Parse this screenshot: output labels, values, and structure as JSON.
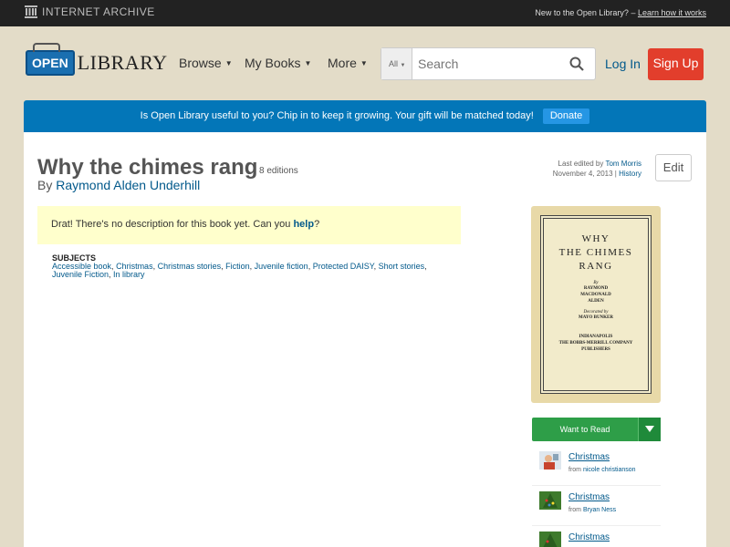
{
  "ia_bar": {
    "logo_text": "INTERNET ARCHIVE",
    "new_text": "New to the Open Library?",
    "learn_link": "Learn how it works"
  },
  "header": {
    "logo_open": "OPEN",
    "logo_library": "LIBRARY",
    "nav": {
      "browse": "Browse",
      "my_books": "My Books",
      "more": "More"
    },
    "search": {
      "scope": "All",
      "placeholder": "Search"
    },
    "login": "Log In",
    "signup": "Sign Up"
  },
  "donate": {
    "message": "Is Open Library useful to you? Chip in to keep it growing. Your gift will be matched today!",
    "button": "Donate"
  },
  "book": {
    "title": "Why the chimes rang",
    "editions": "8 editions",
    "by": "By",
    "author": "Raymond Alden Underhill",
    "last_edited_prefix": "Last edited by",
    "last_edited_user": "Tom Morris",
    "last_edited_date": "November 4, 2013",
    "history": "History",
    "edit": "Edit",
    "no_description": "Drat! There's no description for this book yet. Can you",
    "help": "help",
    "help_suffix": "?",
    "subjects_heading": "SUBJECTS",
    "subjects": [
      "Accessible book",
      "Christmas",
      "Christmas stories",
      "Fiction",
      "Juvenile fiction",
      "Protected DAISY",
      "Short stories",
      "Juvenile Fiction",
      "In library"
    ]
  },
  "cover": {
    "line1": "WHY",
    "line2": "THE CHIMES",
    "line3": "RANG",
    "by": "By",
    "author1": "RAYMOND",
    "author2": "MACDONALD",
    "author3": "ALDEN",
    "decorated": "Decorated by",
    "artist": "MAYO BUNKER",
    "city": "INDIANAPOLIS",
    "publisher": "THE BOBBS-MERRILL COMPANY",
    "publishers": "PUBLISHERS"
  },
  "want_to_read": "Want to Read",
  "lists": [
    {
      "name": "Christmas",
      "from": "from",
      "user": "nicole christianson"
    },
    {
      "name": "Christmas",
      "from": "from",
      "user": "Bryan Ness"
    },
    {
      "name": "Christmas",
      "from": "",
      "user": ""
    }
  ]
}
